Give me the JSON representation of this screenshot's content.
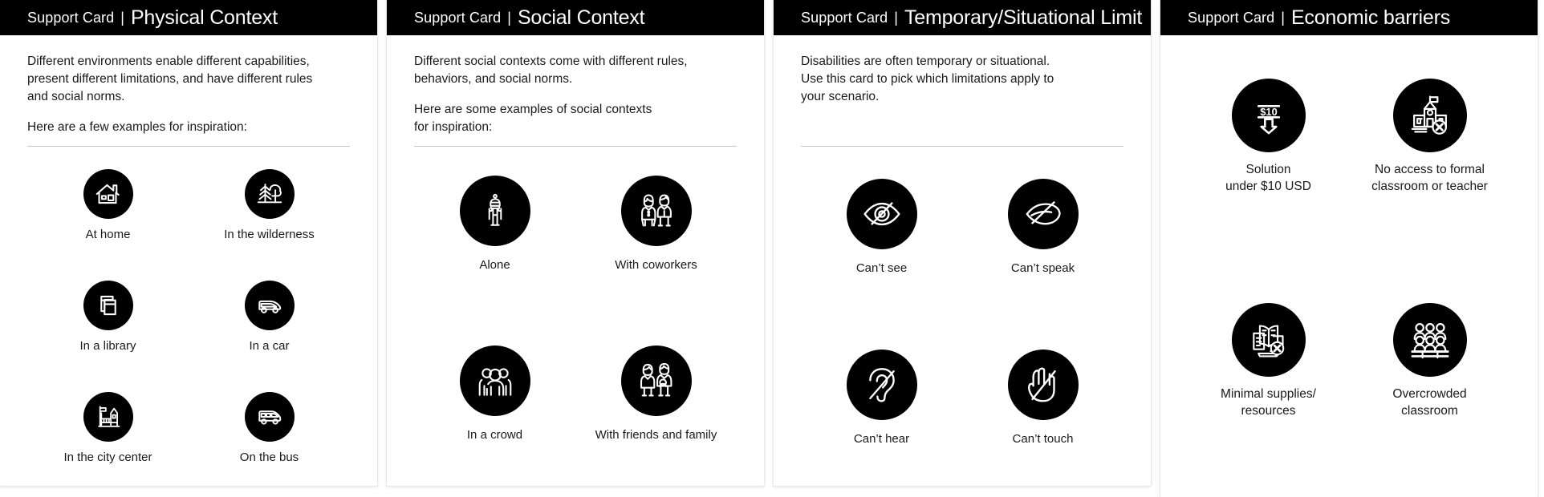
{
  "cards": [
    {
      "prefix": "Support Card",
      "separator": "|",
      "title": "Physical Context",
      "intro_1": "Different environments enable different capabilities,\npresent different limitations, and have different rules\nand social norms.",
      "intro_2": "Here are a few examples for inspiration:",
      "items": [
        {
          "label": "At home",
          "icon": "house-icon"
        },
        {
          "label": "In the wilderness",
          "icon": "tree-forest-icon"
        },
        {
          "label": "In a library",
          "icon": "books-icon"
        },
        {
          "label": "In a car",
          "icon": "car-icon"
        },
        {
          "label": "In the city center",
          "icon": "city-buildings-icon"
        },
        {
          "label": "On the bus",
          "icon": "bus-icon"
        }
      ]
    },
    {
      "prefix": "Support Card",
      "separator": "|",
      "title": "Social Context",
      "intro_1": "Different social contexts come with different rules,\nbehaviors, and social norms.",
      "intro_2": "Here are some examples of social contexts\nfor inspiration:",
      "items": [
        {
          "label": "Alone",
          "icon": "single-person-icon"
        },
        {
          "label": "With coworkers",
          "icon": "two-coworkers-icon"
        },
        {
          "label": "In a crowd",
          "icon": "crowd-group-icon"
        },
        {
          "label": "With friends and family",
          "icon": "family-group-icon"
        }
      ]
    },
    {
      "prefix": "Support Card",
      "separator": "|",
      "title": "Temporary/Situational Limit",
      "intro_1": "Disabilities are often temporary or situational.\nUse this card to pick which limitations apply to\nyour scenario.",
      "intro_2": "",
      "items": [
        {
          "label": "Can’t see",
          "icon": "eye-slash-icon"
        },
        {
          "label": "Can’t speak",
          "icon": "mouth-slash-icon"
        },
        {
          "label": "Can’t hear",
          "icon": "ear-slash-icon"
        },
        {
          "label": "Can’t touch",
          "icon": "hand-slash-icon"
        }
      ]
    },
    {
      "prefix": "Support Card",
      "separator": "|",
      "title": "Economic barriers",
      "intro_1": "",
      "intro_2": "",
      "items": [
        {
          "label": "Solution\nunder $10 USD",
          "icon": "price-under-ten-icon",
          "badge_text": "$10"
        },
        {
          "label": "No access to formal\nclassroom or teacher",
          "icon": "school-blocked-icon"
        },
        {
          "label": "Minimal supplies/\nresources",
          "icon": "supplies-blocked-icon"
        },
        {
          "label": "Overcrowded\nclassroom",
          "icon": "overcrowded-classroom-icon"
        }
      ]
    }
  ],
  "colors": {
    "header_bg": "#000000",
    "header_text": "#ffffff",
    "body_text": "#1a1a1a",
    "badge_bg": "#000000",
    "badge_fg": "#ffffff",
    "rule": "#c8c8c8",
    "page_bg": "#ffffff"
  }
}
